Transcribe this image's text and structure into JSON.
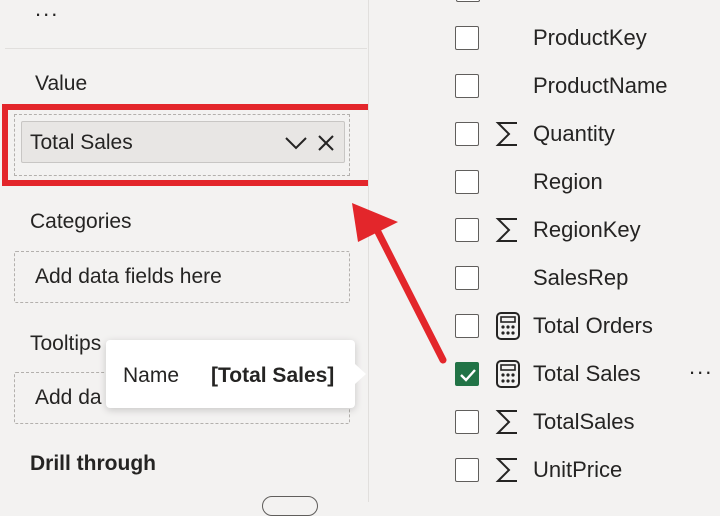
{
  "left_panel": {
    "more_label": "...",
    "value_section": {
      "label": "Value",
      "field": "Total Sales"
    },
    "categories_section": {
      "label": "Categories",
      "placeholder": "Add data fields here"
    },
    "tooltips_section": {
      "label": "Tooltips",
      "placeholder": "Add da"
    },
    "drill_through_label": "Drill through"
  },
  "tooltip": {
    "key": "Name",
    "value": "[Total Sales]"
  },
  "field_list": [
    {
      "name": "ProductKey",
      "icon": "none",
      "checked": false
    },
    {
      "name": "ProductName",
      "icon": "none",
      "checked": false
    },
    {
      "name": "Quantity",
      "icon": "sigma-icon",
      "checked": false
    },
    {
      "name": "Region",
      "icon": "none",
      "checked": false
    },
    {
      "name": "RegionKey",
      "icon": "sigma-icon",
      "checked": false
    },
    {
      "name": "SalesRep",
      "icon": "none",
      "checked": false
    },
    {
      "name": "Total Orders",
      "icon": "calculator-icon",
      "checked": false
    },
    {
      "name": "Total Sales",
      "icon": "calculator-icon",
      "checked": true,
      "more": "..."
    },
    {
      "name": "TotalSales",
      "icon": "sigma-icon",
      "checked": false
    },
    {
      "name": "UnitPrice",
      "icon": "sigma-icon",
      "checked": false
    }
  ],
  "colors": {
    "highlight": "#e3262b",
    "checked": "#217346",
    "panel_bg": "#f3f2f1"
  }
}
